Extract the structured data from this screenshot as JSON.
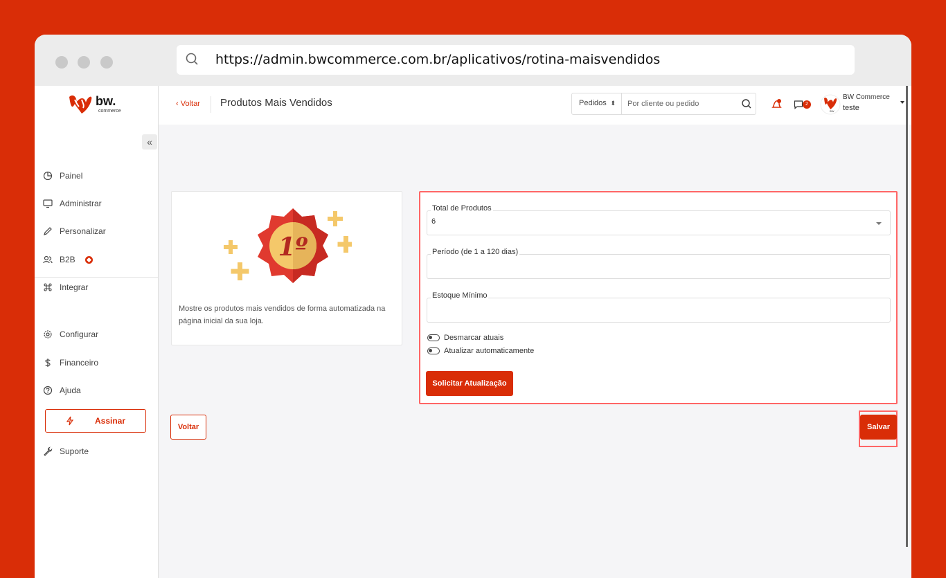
{
  "browser": {
    "url": "https://admin.bwcommerce.com.br/aplicativos/rotina-maisvendidos"
  },
  "brand": {
    "logo_text": "bw.",
    "logo_sub": "commerce",
    "accent_color": "#d92d07"
  },
  "sidebar": {
    "items": [
      {
        "label": "Painel",
        "icon": "pie-chart-icon"
      },
      {
        "label": "Administrar",
        "icon": "monitor-icon"
      },
      {
        "label": "Personalizar",
        "icon": "pencil-icon"
      },
      {
        "label": "B2B",
        "icon": "users-icon"
      },
      {
        "label": "Integrar",
        "icon": "command-icon"
      },
      {
        "label": "Configurar",
        "icon": "gear-icon"
      },
      {
        "label": "Financeiro",
        "icon": "dollar-icon"
      },
      {
        "label": "Ajuda",
        "icon": "help-circle-icon"
      },
      {
        "label": "Suporte",
        "icon": "wrench-icon"
      }
    ],
    "subscribe_label": "Assinar"
  },
  "header": {
    "back_label": "‹ Voltar",
    "page_title": "Produtos Mais Vendidos",
    "search": {
      "scope": "Pedidos",
      "placeholder": "Por cliente ou pedido"
    },
    "chat_count": "2",
    "user": {
      "name": "BW Commerce",
      "store": "teste"
    }
  },
  "app_card": {
    "badge_text": "1º",
    "description": "Mostre os produtos mais vendidos de forma automatizada na página inicial da sua loja."
  },
  "form": {
    "total_products": {
      "label": "Total de Produtos",
      "value": "6"
    },
    "period": {
      "label": "Período (de 1 a 120 dias)",
      "value": ""
    },
    "min_stock": {
      "label": "Estoque Mínimo",
      "value": ""
    },
    "toggles": [
      {
        "label": "Desmarcar atuais"
      },
      {
        "label": "Atualizar automaticamente"
      }
    ],
    "request_update_label": "Solicitar Atualização"
  },
  "actions": {
    "back_label": "Voltar",
    "save_label": "Salvar"
  }
}
